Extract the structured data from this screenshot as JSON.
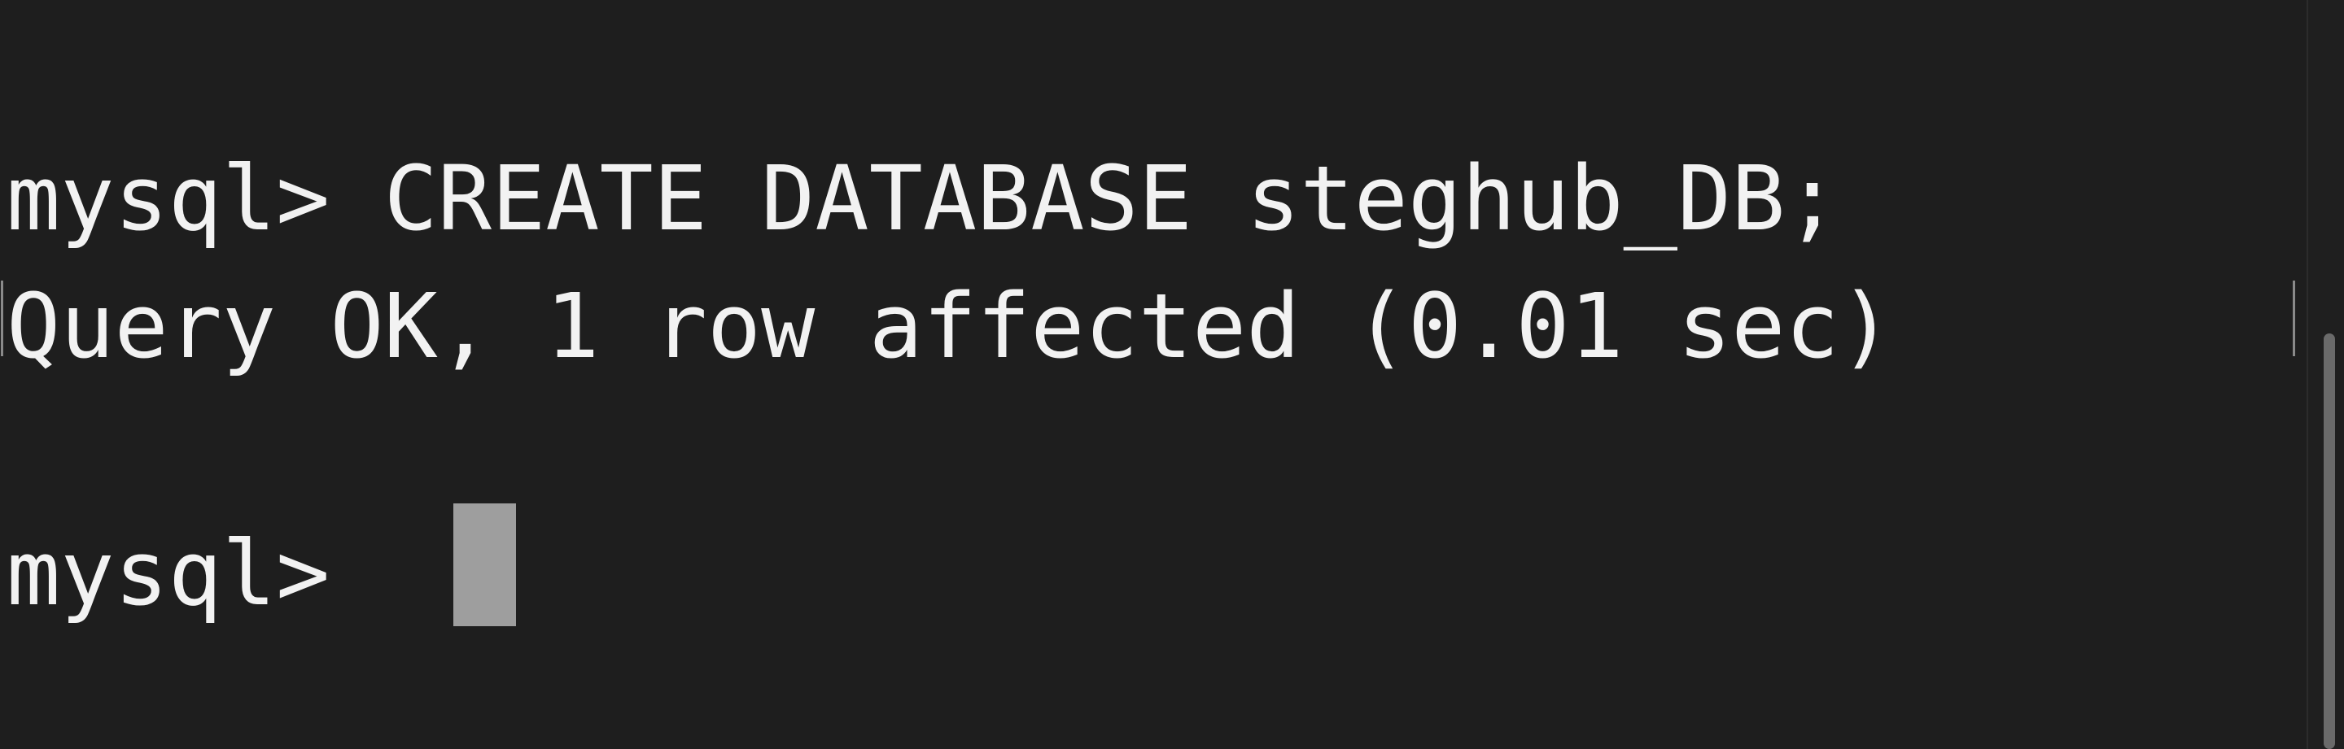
{
  "terminal": {
    "lines": [
      "mysql> CREATE DATABASE steghub_DB;",
      "Query OK, 1 row affected (0.01 sec)",
      "mysql> "
    ]
  }
}
